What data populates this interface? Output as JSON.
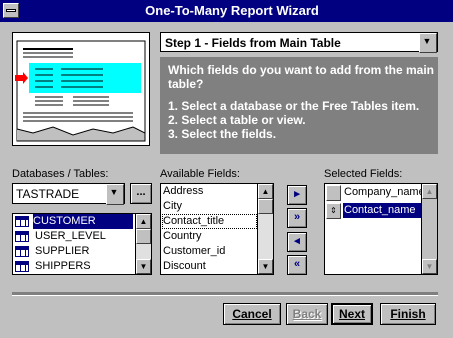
{
  "window": {
    "title": "One-To-Many Report Wizard"
  },
  "step": {
    "selected": "Step 1 - Fields from Main Table"
  },
  "instructions": {
    "line1": "Which fields do you want to add from the main",
    "line2": "table?",
    "line3": "1. Select a database or the Free Tables item.",
    "line4": "2. Select a table or view.",
    "line5": "3. Select the fields."
  },
  "databases": {
    "label": "Databases / Tables:",
    "selected": "TASTRADE",
    "browse_label": "...",
    "tables": [
      "CUSTOMER",
      "USER_LEVEL",
      "SUPPLIER",
      "SHIPPERS"
    ],
    "selected_index": 0
  },
  "available": {
    "label": "Available Fields:",
    "items": [
      "Address",
      "City",
      "Contact_title",
      "Country",
      "Customer_id",
      "Discount"
    ],
    "focused_index": 2
  },
  "selected_fields": {
    "label": "Selected Fields:",
    "items": [
      "Company_name",
      "Contact_name"
    ],
    "selected_index": 1
  },
  "move_buttons": {
    "add": "▸",
    "add_all": "»",
    "remove": "◂",
    "remove_all": "«"
  },
  "buttons": {
    "cancel": "Cancel",
    "back": "Back",
    "next": "Next",
    "finish": "Finish"
  },
  "colors": {
    "title_bar": "#000080",
    "highlight": "#000080",
    "illustration_band": "#00ffff",
    "arrow": "#ff0000"
  }
}
